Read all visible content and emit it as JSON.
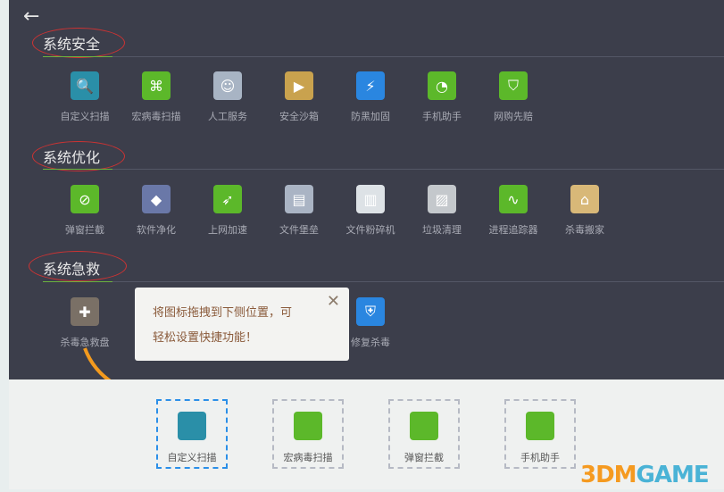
{
  "sections": [
    {
      "title": "系统安全",
      "items": [
        {
          "label": "自定义扫描",
          "icon": "magnifier-icon",
          "color": "#2a8fa8"
        },
        {
          "label": "宏病毒扫描",
          "icon": "macro-virus-icon",
          "color": "#5cb82a"
        },
        {
          "label": "人工服务",
          "icon": "doctor-icon",
          "color": "#a8b4c4"
        },
        {
          "label": "安全沙箱",
          "icon": "sandbox-icon",
          "color": "#c9a24e"
        },
        {
          "label": "防黑加固",
          "icon": "lightning-icon",
          "color": "#2a86e0"
        },
        {
          "label": "手机助手",
          "icon": "phone-assistant-icon",
          "color": "#5cb82a"
        },
        {
          "label": "网购先赔",
          "icon": "shopping-shield-icon",
          "color": "#5cb82a"
        }
      ]
    },
    {
      "title": "系统优化",
      "items": [
        {
          "label": "弹窗拦截",
          "icon": "popup-block-icon",
          "color": "#5cb82a"
        },
        {
          "label": "软件净化",
          "icon": "software-clean-icon",
          "color": "#6a78a8"
        },
        {
          "label": "上网加速",
          "icon": "rocket-icon",
          "color": "#5cb82a"
        },
        {
          "label": "文件堡垒",
          "icon": "file-fortress-icon",
          "color": "#aab4c4"
        },
        {
          "label": "文件粉碎机",
          "icon": "shredder-icon",
          "color": "#dde2e6"
        },
        {
          "label": "垃圾清理",
          "icon": "junk-clean-icon",
          "color": "#c4c8cc"
        },
        {
          "label": "进程追踪器",
          "icon": "process-tracker-icon",
          "color": "#5cb82a"
        },
        {
          "label": "杀毒搬家",
          "icon": "house-icon",
          "color": "#d8b878"
        }
      ]
    },
    {
      "title": "系统急救",
      "items": [
        {
          "label": "杀毒急救盘",
          "icon": "rescue-disk-icon",
          "color": "#7a7066"
        },
        {
          "label": "修复杀毒",
          "icon": "repair-shield-icon",
          "color": "#2a86e0"
        }
      ]
    }
  ],
  "tooltip": {
    "line1": "将图标拖拽到下侧位置，可",
    "line2": "轻松设置快捷功能！",
    "close": "✕"
  },
  "shortcuts": [
    {
      "label": "自定义扫描",
      "color": "#2a8fa8"
    },
    {
      "label": "宏病毒扫描",
      "color": "#5cb82a"
    },
    {
      "label": "弹窗拦截",
      "color": "#5cb82a"
    },
    {
      "label": "手机助手",
      "color": "#5cb82a"
    }
  ],
  "watermark": {
    "a": "3DM",
    "b": "GAME"
  },
  "back": "←"
}
